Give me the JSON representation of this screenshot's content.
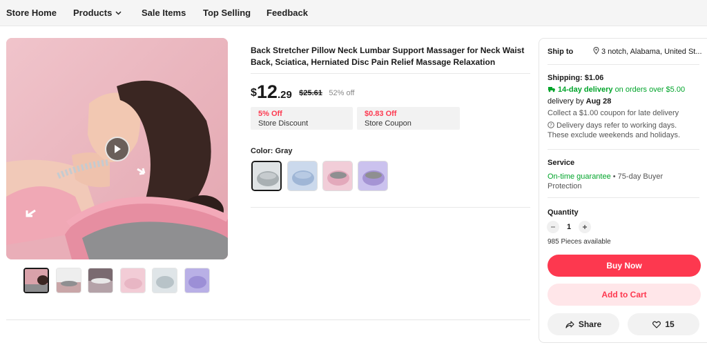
{
  "nav": {
    "items": [
      "Store Home",
      "Products",
      "Sale Items",
      "Top Selling",
      "Feedback"
    ]
  },
  "product": {
    "title": "Back Stretcher Pillow Neck Lumbar Support Massager for Neck Waist Back, Sciatica, Herniated Disc Pain Relief Massage Relaxation",
    "price": {
      "currency": "$",
      "integer": "12",
      "decimal": ".29",
      "original": "$25.61",
      "discount": "52% off"
    },
    "coupons": [
      {
        "top": "5% Off",
        "bottom": "Store Discount"
      },
      {
        "top": "$0.83 Off",
        "bottom": "Store Coupon"
      }
    ],
    "color_label": "Color: Gray",
    "swatch_colors": [
      "#a9b0b3",
      "#9fb6d6",
      "#e3a9bb",
      "#a594d4"
    ],
    "thumb_colors": [
      "#d9a2aa",
      "#c9a6a8",
      "#b4a2a8",
      "#e8b6c4",
      "#b8c3c8",
      "#9c8fd6"
    ]
  },
  "panel": {
    "ship_to_label": "Ship to",
    "ship_to_address": "3 notch, Alabama, United St...",
    "shipping": "Shipping: $1.06",
    "delivery_fast": "14-day delivery",
    "delivery_fast_rest": "on orders over $5.00",
    "delivery_by_prefix": "delivery by ",
    "delivery_by_date": "Aug 28",
    "late_coupon": "Collect a $1.00 coupon for late delivery",
    "note_line1": "Delivery days refer to working days.",
    "note_line2": "These exclude weekends and holidays.",
    "service_label": "Service",
    "service_guarantee": "On-time guarantee",
    "service_rest": " • 75-day Buyer",
    "service_line2": "Protection",
    "quantity_label": "Quantity",
    "quantity_value": "1",
    "available": "985 Pieces available",
    "buy_now": "Buy Now",
    "add_to_cart": "Add to Cart",
    "share": "Share",
    "wishlist_count": "15"
  },
  "colors": {
    "accent": "#fd384f",
    "accent_light": "#ffe6e9",
    "green": "#00a42a"
  }
}
